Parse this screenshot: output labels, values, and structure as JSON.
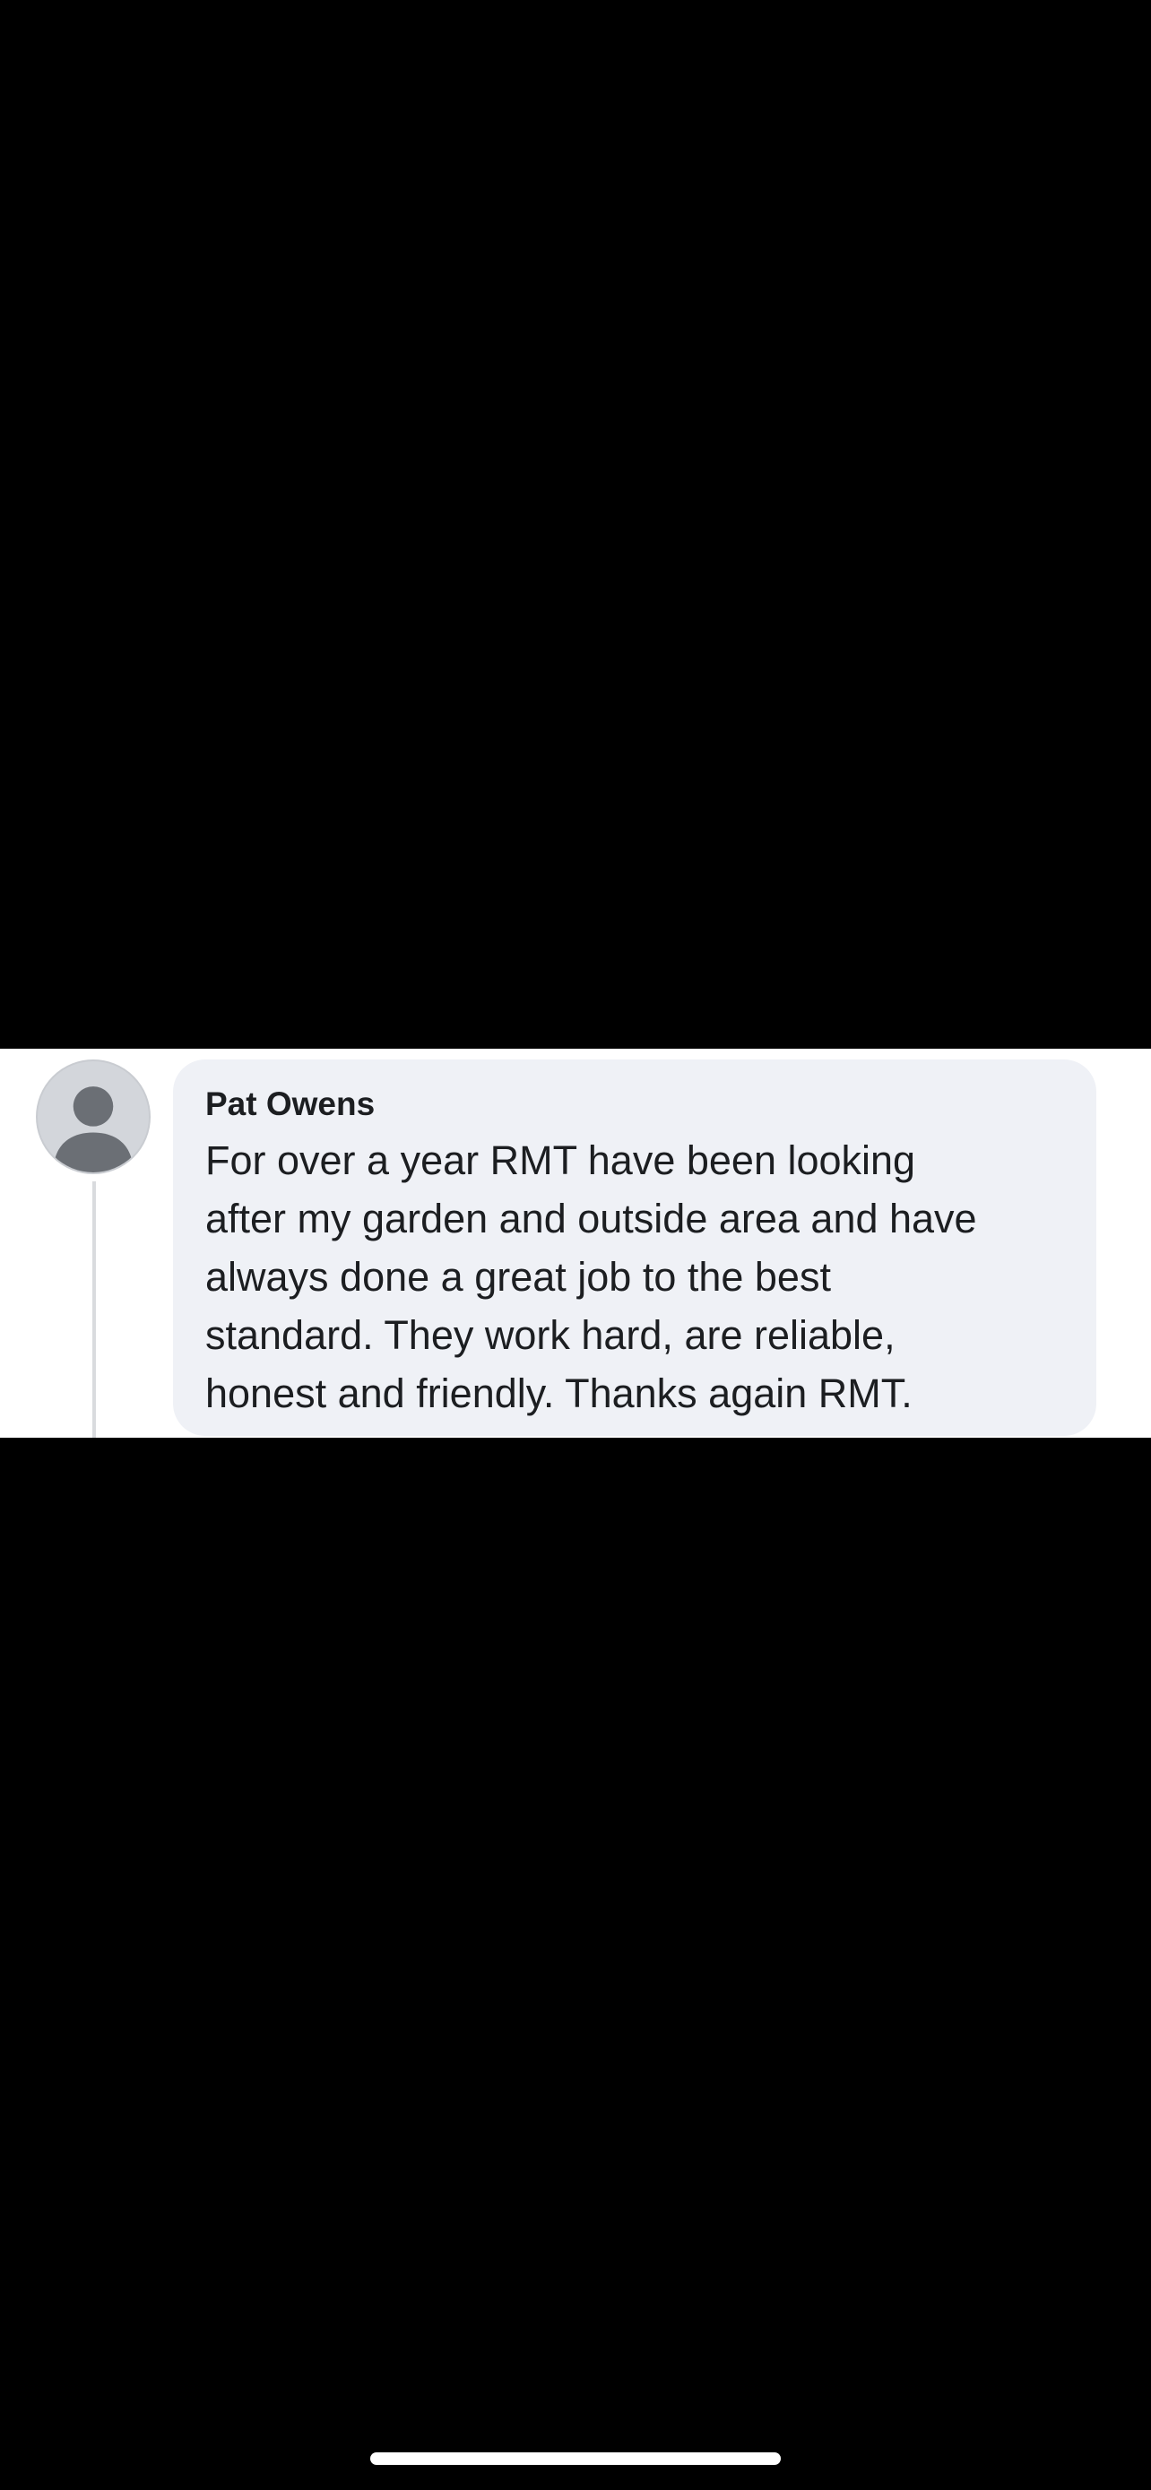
{
  "comment": {
    "author": "Pat Owens",
    "text": "For over a year RMT have been looking\nafter my garden and outside area and have\nalways done a great job to the best\nstandard. They work hard, are reliable,\nhonest and friendly. Thanks again RMT.",
    "avatar_icon": "default-profile-icon"
  },
  "colors": {
    "background": "#000000",
    "bubble": "#eff1f6",
    "text": "#1c1e21",
    "avatar": "#d3d6db",
    "avatar_silhouette": "#6b6f75"
  }
}
